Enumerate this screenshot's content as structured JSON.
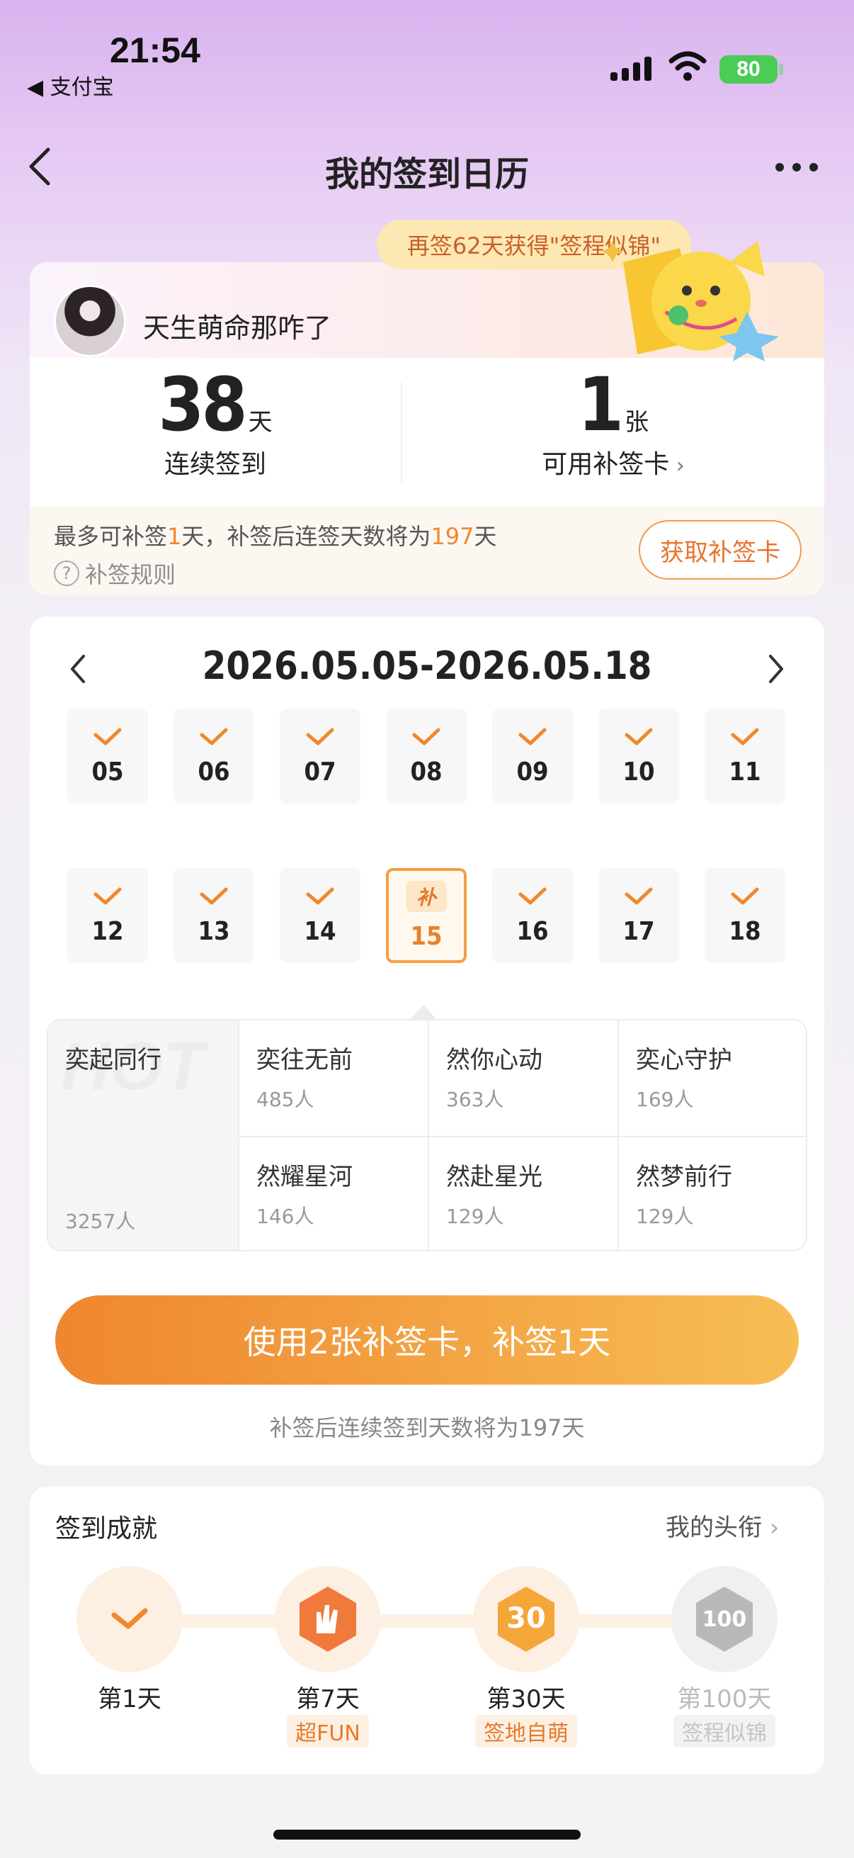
{
  "status": {
    "time": "21:54",
    "back_app": "◀ 支付宝",
    "battery": "80"
  },
  "nav": {
    "title": "我的签到日历"
  },
  "banner": {
    "text": "再签62天获得\"签程似锦\""
  },
  "user": {
    "nickname": "天生萌命那咋了"
  },
  "stats": {
    "streak_value": "38",
    "streak_unit": "天",
    "streak_label": "连续签到",
    "cards_value": "1",
    "cards_unit": "张",
    "cards_label": "可用补签卡"
  },
  "tip": {
    "prefix": "最多可补签",
    "days": "1",
    "middle": "天，补签后连签天数将为",
    "total": "197",
    "suffix": "天",
    "rule_link": "补签规则",
    "get_card_button": "获取补签卡"
  },
  "calendar": {
    "range": "2026.05.05-2026.05.18",
    "makeup_badge": "补",
    "days": [
      {
        "day": "05",
        "state": "checked"
      },
      {
        "day": "06",
        "state": "checked"
      },
      {
        "day": "07",
        "state": "checked"
      },
      {
        "day": "08",
        "state": "checked"
      },
      {
        "day": "09",
        "state": "checked"
      },
      {
        "day": "10",
        "state": "checked"
      },
      {
        "day": "11",
        "state": "checked"
      },
      {
        "day": "12",
        "state": "checked"
      },
      {
        "day": "13",
        "state": "checked"
      },
      {
        "day": "14",
        "state": "checked"
      },
      {
        "day": "15",
        "state": "makeup"
      },
      {
        "day": "16",
        "state": "checked"
      },
      {
        "day": "17",
        "state": "checked"
      },
      {
        "day": "18",
        "state": "checked"
      }
    ]
  },
  "titles": {
    "hot_watermark": "HOT",
    "items": [
      {
        "name": "奕起同行",
        "count": "3257人"
      },
      {
        "name": "奕往无前",
        "count": "485人"
      },
      {
        "name": "然你心动",
        "count": "363人"
      },
      {
        "name": "奕心守护",
        "count": "169人"
      },
      {
        "name": "然耀星河",
        "count": "146人"
      },
      {
        "name": "然赴星光",
        "count": "129人"
      },
      {
        "name": "然梦前行",
        "count": "129人"
      }
    ]
  },
  "action": {
    "button": "使用2张补签卡，补签1天",
    "hint": "补签后连续签到天数将为197天"
  },
  "achievements": {
    "title": "签到成就",
    "link": "我的头衔",
    "items": [
      {
        "day": "第1天",
        "tag": "",
        "unlocked": true
      },
      {
        "day": "第7天",
        "tag": "超FUN",
        "unlocked": true
      },
      {
        "day": "第30天",
        "tag": "签地自萌",
        "unlocked": true
      },
      {
        "day": "第100天",
        "tag": "签程似锦",
        "unlocked": false
      }
    ]
  },
  "colors": {
    "accent": "#f0882c",
    "button_start": "#ef8630",
    "button_end": "#f7be54"
  }
}
